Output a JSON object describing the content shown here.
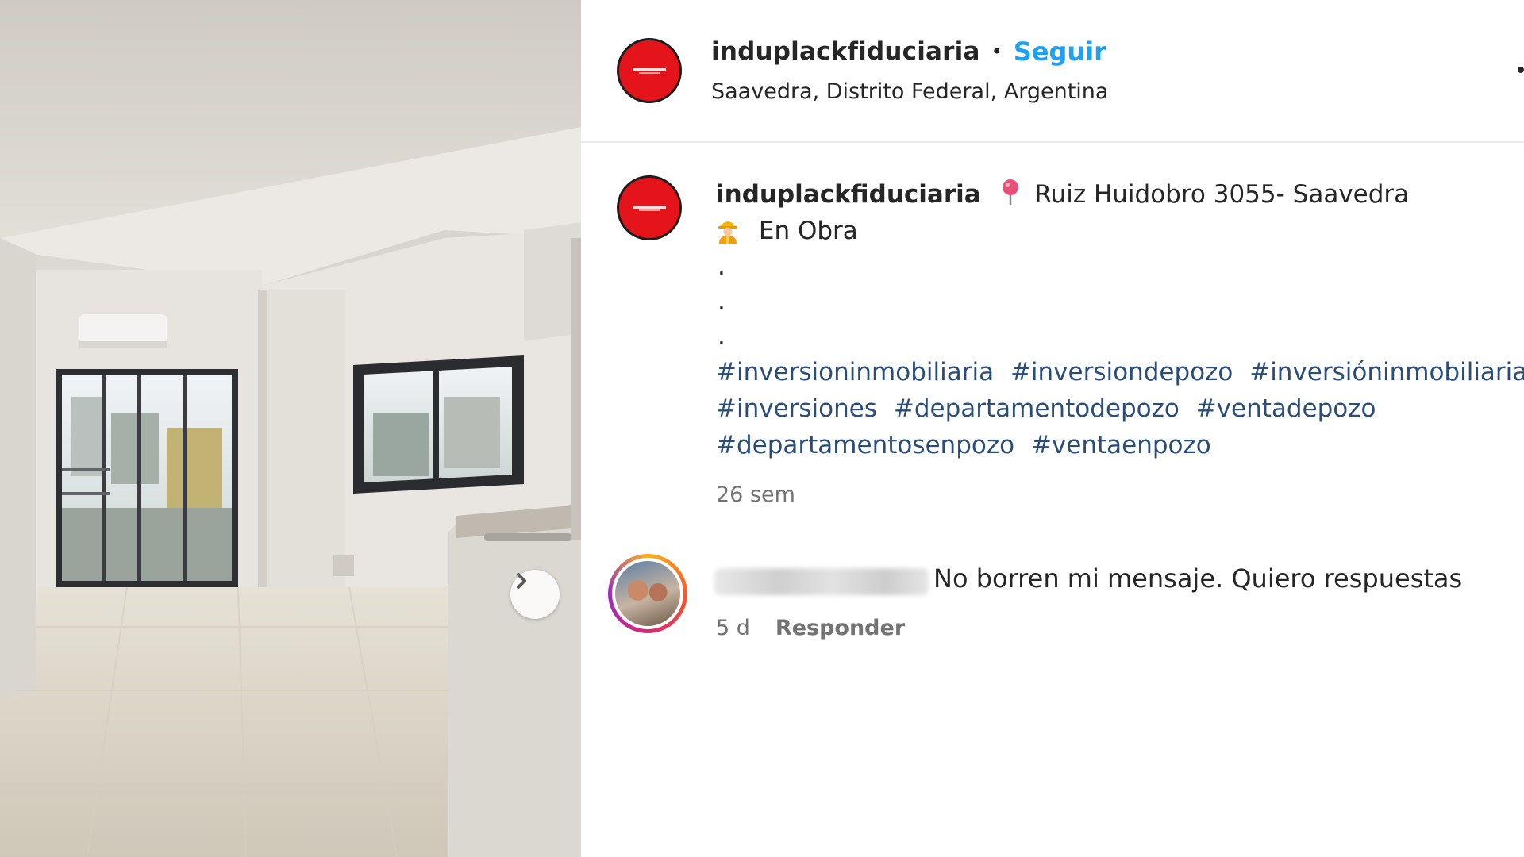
{
  "post": {
    "username": "induplackfiduciaria",
    "dot": "•",
    "follow_label": "Seguir",
    "location": "Saavedra, Distrito Federal, Argentina"
  },
  "caption": {
    "username": "induplackfiduciaria",
    "address": "Ruiz Huidobro 3055- Saavedra",
    "status": "En Obra",
    "dots": [
      ".",
      ".",
      "."
    ],
    "hashtag_lines": [
      [
        "#inversioninmobiliaria",
        "#inversiondepozo",
        "#inversióninmobiliaria"
      ],
      [
        "#inversiones",
        "#departamentodepozo",
        "#ventadepozo"
      ],
      [
        "#departamentosenpozo",
        "#ventaenpozo"
      ]
    ],
    "time_ago": "26 sem"
  },
  "comment": {
    "text": "No borren mi mensaje. Quiero respuestas",
    "time_ago": "5 d",
    "reply_label": "Responder"
  },
  "icons": {
    "next": "chevron-right-icon",
    "pin": "round-pushpin-icon",
    "status": "construction-worker-icon",
    "more": "more-options-icon"
  },
  "colors": {
    "follow": "#1fa0f0",
    "hashtag": "#2b4d7a",
    "avatar_brand": "#e4141a",
    "muted_text": "#737373"
  }
}
